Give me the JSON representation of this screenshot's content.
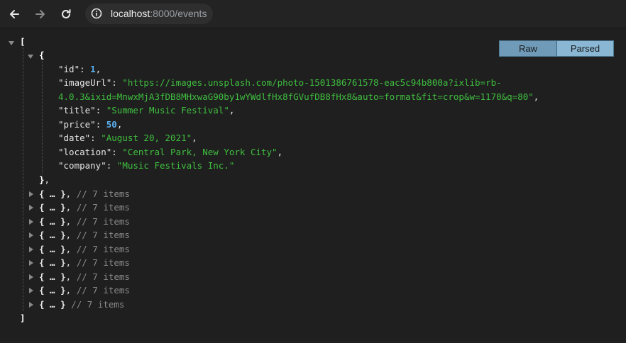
{
  "browser": {
    "url_host": "localhost",
    "url_path": ":8000/events",
    "icons": [
      "back-arrow-icon",
      "forward-arrow-icon",
      "reload-icon",
      "info-icon"
    ]
  },
  "viewer": {
    "raw_label": "Raw",
    "parsed_label": "Parsed"
  },
  "json": {
    "open_bracket": "[",
    "close_bracket": "]",
    "first_item": {
      "id_key": "\"id\"",
      "id_value": "1",
      "imageUrl_key": "\"imageUrl\"",
      "imageUrl_value_line1": "\"https://images.unsplash.com/photo-1501386761578-eac5c94b800a?ixlib=rb-",
      "imageUrl_value_line2": "4.0.3&ixid=MnwxMjA3fDB8MHxwaG90by1wYWdlfHx8fGVufDB8fHx8&auto=format&fit=crop&w=1170&q=80\"",
      "title_key": "\"title\"",
      "title_value": "\"Summer Music Festival\"",
      "price_key": "\"price\"",
      "price_value": "50",
      "date_key": "\"date\"",
      "date_value": "\"August 20, 2021\"",
      "location_key": "\"location\"",
      "location_value": "\"Central Park, New York City\"",
      "company_key": "\"company\"",
      "company_value": "\"Music Festivals Inc.\""
    },
    "collapsed_items": [
      {
        "summary": "{ … }",
        "comment": "// 7 items",
        "comma": ","
      },
      {
        "summary": "{ … }",
        "comment": "// 7 items",
        "comma": ","
      },
      {
        "summary": "{ … }",
        "comment": "// 7 items",
        "comma": ","
      },
      {
        "summary": "{ … }",
        "comment": "// 7 items",
        "comma": ","
      },
      {
        "summary": "{ … }",
        "comment": "// 7 items",
        "comma": ","
      },
      {
        "summary": "{ … }",
        "comment": "// 7 items",
        "comma": ","
      },
      {
        "summary": "{ … }",
        "comment": "// 7 items",
        "comma": ","
      },
      {
        "summary": "{ … }",
        "comment": "// 7 items",
        "comma": ","
      },
      {
        "summary": "{ … }",
        "comment": "// 7 items",
        "comma": ""
      }
    ]
  }
}
